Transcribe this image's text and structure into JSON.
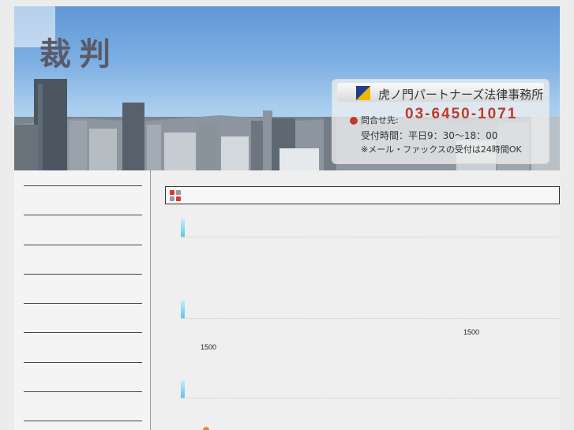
{
  "header": {
    "title": "裁判"
  },
  "contact": {
    "firm_name": "虎ノ門パートナーズ法律事務所",
    "phone_label": "問合せ先:",
    "phone": "03-6450-1071",
    "hours": "受付時間：平日9：30～18：00",
    "note": "※メール・ファックスの受付は24時間OK"
  },
  "sidebar": {
    "items": [
      "",
      "",
      "",
      "",
      "",
      "",
      "",
      "",
      ""
    ]
  },
  "main": {
    "title": "",
    "sections": [
      "",
      "",
      ""
    ],
    "figures": [
      "1500",
      "1500"
    ]
  },
  "colors": {
    "accent_red": "#c0392b",
    "section_marker": "#5ac8ea"
  }
}
